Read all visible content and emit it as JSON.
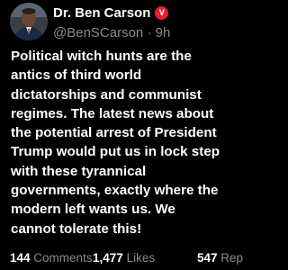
{
  "post": {
    "author": {
      "display_name": "Dr. Ben Carson",
      "verified_badge": "V",
      "handle": "@BenSCarson",
      "separator": "·",
      "time": "9h"
    },
    "body_lines": [
      "Political witch hunts are the",
      "antics of third world",
      "dictatorships and communist",
      "regimes. The latest news about",
      "the potential arrest of President",
      "Trump would put us in lock step",
      "with these tyrannical",
      "governments, exactly where the",
      "modern left wants us. We",
      "cannot tolerate this!"
    ],
    "stats": {
      "comments": {
        "count": "144",
        "label": "Comments"
      },
      "likes": {
        "count": "1,477",
        "label": "Likes"
      },
      "reposts": {
        "count": "547",
        "label": "Rep"
      }
    }
  },
  "colors": {
    "background": "#000000",
    "text": "#ffffff",
    "muted": "#8b8b8f",
    "verified_badge": "#e4212b"
  }
}
